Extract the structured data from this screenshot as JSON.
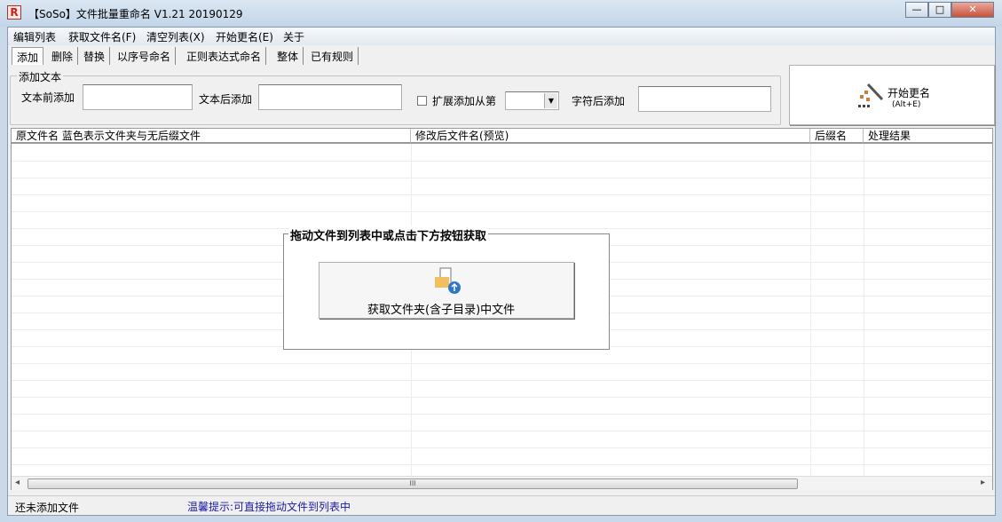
{
  "window": {
    "title": "【SoSo】文件批量重命名  V1.21 20190129",
    "icon_letter": "R",
    "minimize": "—",
    "maximize": "□",
    "close": "✕"
  },
  "menu": [
    "编辑列表",
    "获取文件名(F)",
    "清空列表(X)",
    "开始更名(E)",
    "关于"
  ],
  "tabs": [
    "添加",
    "删除",
    "替换",
    "以序号命名",
    "正则表达式命名",
    "整体",
    "已有规则"
  ],
  "add_group": {
    "title": "添加文本",
    "prefix_label": "文本前添加",
    "prefix_value": "",
    "suffix_label": "文本后添加",
    "suffix_value": "",
    "extend_label": "扩展添加从第",
    "extend_checked": false,
    "position_value": "",
    "after_char_label": "字符后添加",
    "after_char_value": ""
  },
  "start_button": {
    "label": "开始更名",
    "shortcut": "(Alt+E)"
  },
  "list": {
    "columns": [
      "原文件名  蓝色表示文件夹与无后缀文件",
      "修改后文件名(预览)",
      "后缀名",
      "处理结果"
    ],
    "rows": []
  },
  "drop_hint": {
    "title": "拖动文件到列表中或点击下方按钮获取",
    "button": "获取文件夹(含子目录)中文件"
  },
  "scroll": {
    "grip": "III",
    "left": "◂",
    "right": "▸"
  },
  "status": {
    "left": "还未添加文件",
    "tip": "温馨提示:可直接拖动文件到列表中"
  },
  "colors": {
    "tip": "#1a1aa0",
    "accent": "#c97f3a"
  }
}
